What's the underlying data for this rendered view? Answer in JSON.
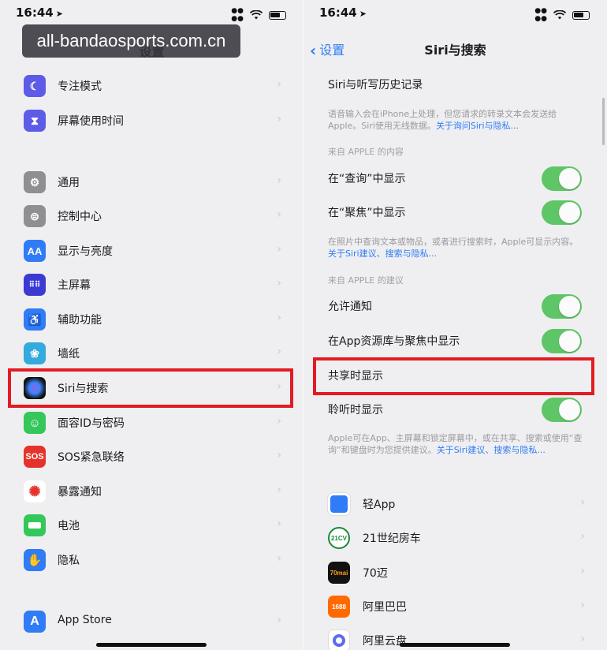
{
  "watermark": "all-bandaosports.com.cn",
  "left": {
    "status": {
      "time": "16:44"
    },
    "title": "设置",
    "items": [
      {
        "label": "专注模式",
        "icon": "moon-icon",
        "color": "#5e5ce6"
      },
      {
        "label": "屏幕使用时间",
        "icon": "hourglass-icon",
        "color": "#5e5ce6"
      },
      {
        "label": "通用",
        "icon": "gear-icon",
        "color": "#8e8e93"
      },
      {
        "label": "控制中心",
        "icon": "toggles-icon",
        "color": "#8e8e93"
      },
      {
        "label": "显示与亮度",
        "icon": "text-size-icon",
        "color": "#2f7cf6"
      },
      {
        "label": "主屏幕",
        "icon": "grid-icon",
        "color": "#3b3bd4"
      },
      {
        "label": "辅助功能",
        "icon": "accessibility-icon",
        "color": "#2f7cf6"
      },
      {
        "label": "墙纸",
        "icon": "flower-icon",
        "color": "#35aadc"
      },
      {
        "label": "Siri与搜索",
        "icon": "siri-icon",
        "color": "#222"
      },
      {
        "label": "面容ID与密码",
        "icon": "face-id-icon",
        "color": "#34c759"
      },
      {
        "label": "SOS紧急联络",
        "icon": "sos-icon",
        "color": "#e5332a"
      },
      {
        "label": "暴露通知",
        "icon": "exposure-icon",
        "color": "#ffffff"
      },
      {
        "label": "电池",
        "icon": "battery-icon",
        "color": "#34c759"
      },
      {
        "label": "隐私",
        "icon": "hand-icon",
        "color": "#2f7cf6"
      },
      {
        "label": "App Store",
        "icon": "app-store-icon",
        "color": "#2f7cf6"
      }
    ]
  },
  "right": {
    "status": {
      "time": "16:44"
    },
    "back_label": "设置",
    "title": "Siri与搜索",
    "history_label": "Siri与听写历史记录",
    "note1": "语音输入会在iPhone上处理，但您请求的转录文本会发送给Apple。Siri使用无线数据。",
    "note1_link": "关于询问Siri与隐私...",
    "section1": "来自 APPLE 的内容",
    "show_in_lookup": "在“查询”中显示",
    "show_in_spotlight": "在“聚焦”中显示",
    "note2": "在照片中查询文本或物品，或者进行搜索时，Apple可显示内容。",
    "note2_link": "关于Siri建议、搜索与隐私...",
    "section2": "来自 APPLE 的建议",
    "allow_notifications": "允许通知",
    "show_in_library": "在App资源库与聚焦中显示",
    "show_when_sharing": "共享时显示",
    "show_when_listening": "聆听时显示",
    "note3": "Apple可在App、主屏幕和锁定屏幕中，或在共享、搜索或使用“查询”和键盘时为您提供建议。",
    "note3_link": "关于Siri建议、搜索与隐私...",
    "apps": [
      {
        "label": "轻App",
        "icon": "light-app-icon",
        "color": "#2f7cf6",
        "text": ""
      },
      {
        "label": "21世纪房车",
        "icon": "rv21-icon",
        "color": "#ffffff",
        "text": "21CV"
      },
      {
        "label": "70迈",
        "icon": "70mai-icon",
        "color": "#111111",
        "text": "70mai"
      },
      {
        "label": "阿里巴巴",
        "icon": "alibaba-icon",
        "color": "#ff6a00",
        "text": "1688"
      },
      {
        "label": "阿里云盘",
        "icon": "aliyun-drive-icon",
        "color": "#ffffff",
        "text": ""
      }
    ]
  }
}
